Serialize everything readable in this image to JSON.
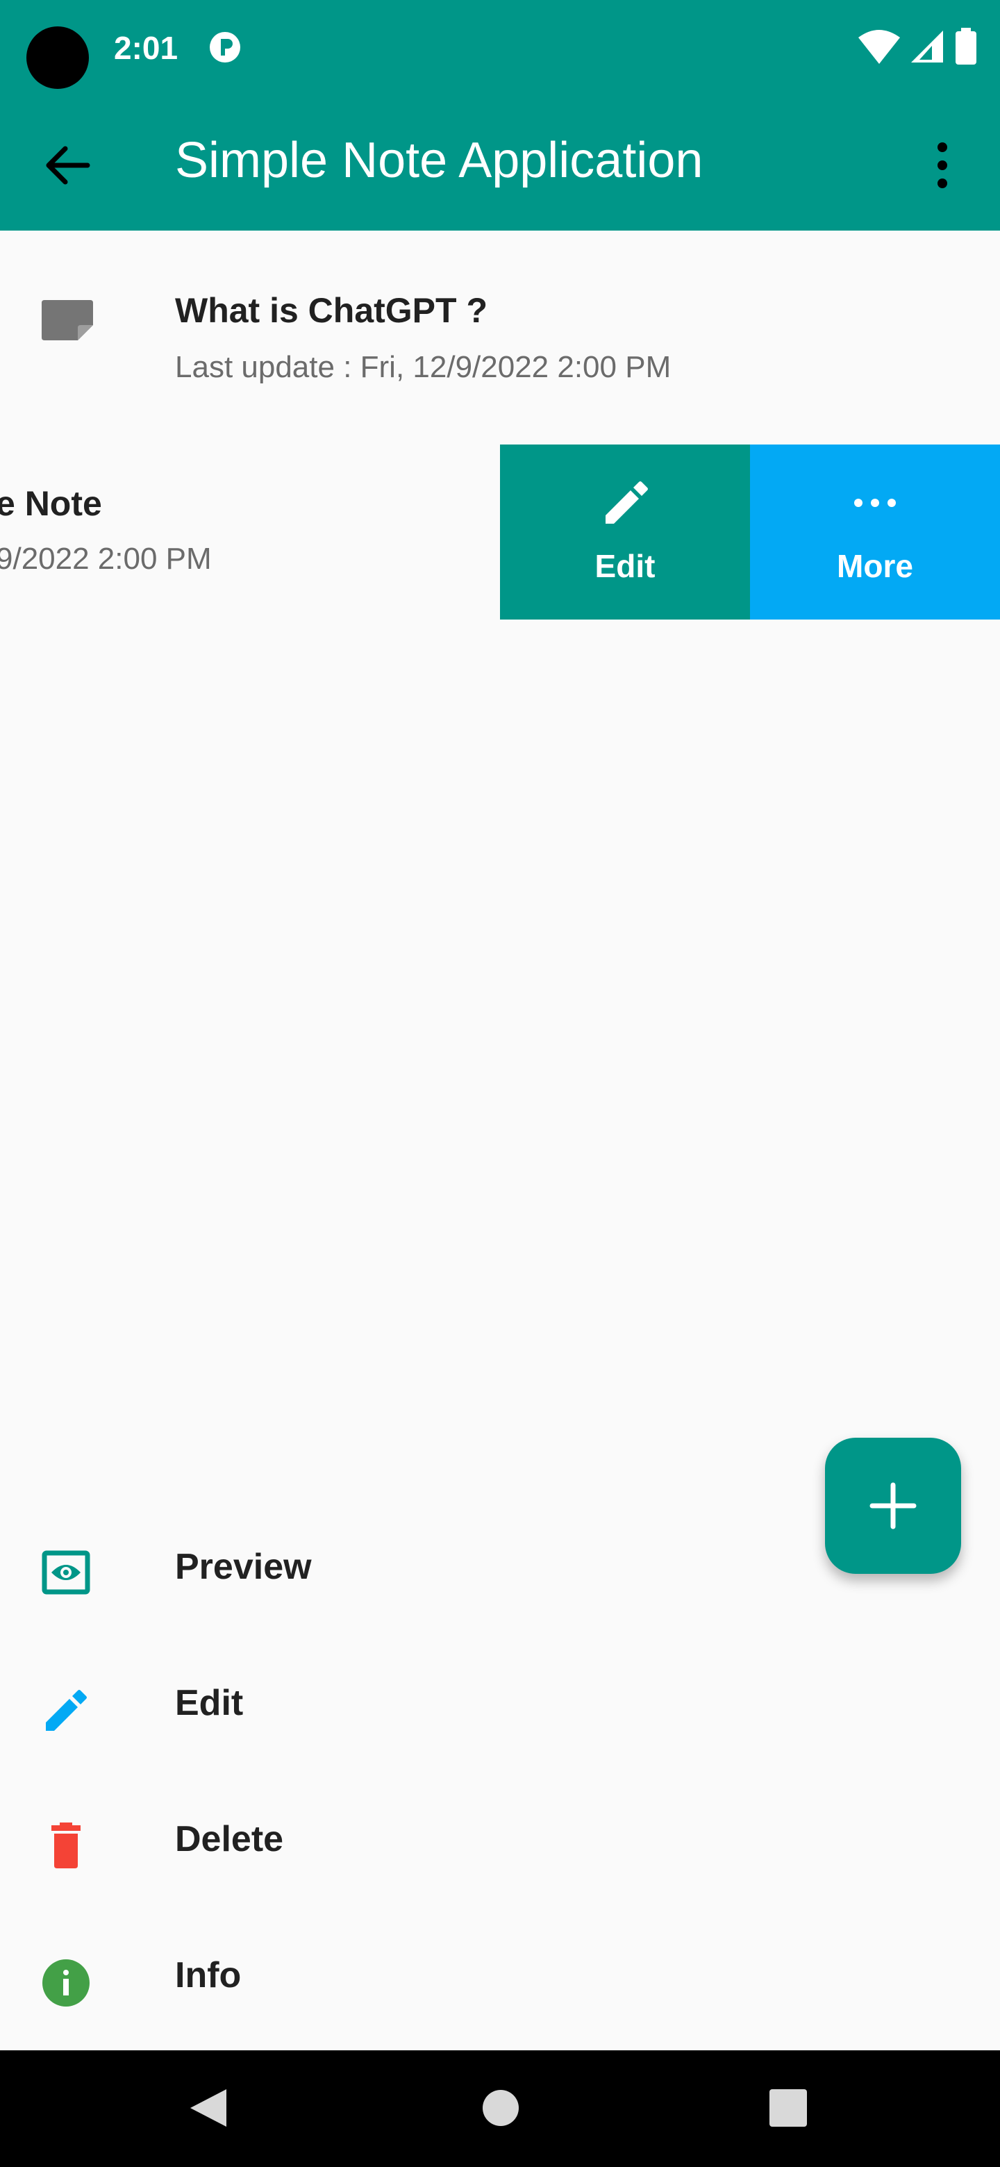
{
  "status_bar": {
    "time": "2:01"
  },
  "app_bar": {
    "title": "Simple Note Application"
  },
  "notes": [
    {
      "title": "What is ChatGPT ?",
      "subtitle": "Last update : Fri, 12/9/2022 2:00 PM"
    },
    {
      "title": "e Note",
      "subtitle": "9/2022 2:00 PM"
    }
  ],
  "swipe_actions": {
    "edit_label": "Edit",
    "more_label": "More"
  },
  "bottom_sheet": [
    {
      "label": "Preview",
      "icon": "eye-icon",
      "color": "#009688"
    },
    {
      "label": "Edit",
      "icon": "pencil-icon",
      "color": "#03a9f4"
    },
    {
      "label": "Delete",
      "icon": "trash-icon",
      "color": "#f44336"
    },
    {
      "label": "Info",
      "icon": "info-icon",
      "color": "#43a047"
    }
  ],
  "colors": {
    "primary": "#009688",
    "accent_blue": "#03a9f4",
    "delete_red": "#f44336",
    "info_green": "#43a047"
  }
}
